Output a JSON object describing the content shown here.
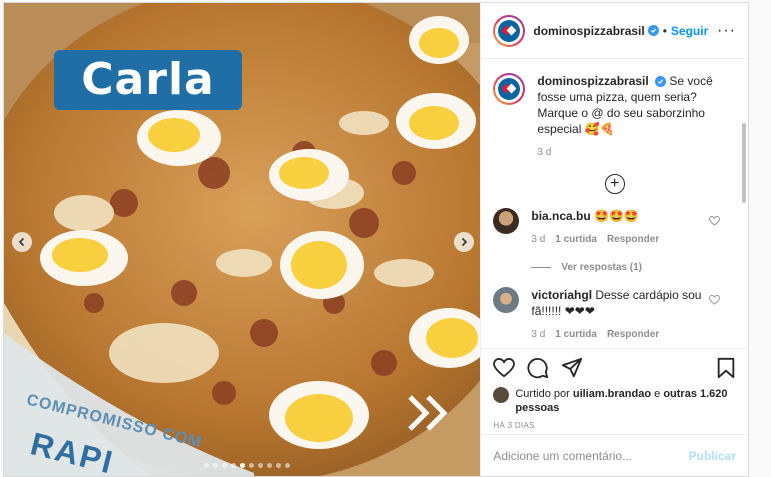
{
  "media": {
    "name_tag": "Carla",
    "box_text_1": "COMPROMISSO COM",
    "box_text_2": "RAPI",
    "slide_count": 10,
    "active_slide": 4
  },
  "header": {
    "username": "dominospizzabrasil",
    "bullet": "•",
    "follow_label": "Seguir",
    "more_label": "···",
    "avatar_icon": "dominos-logo-icon",
    "avatar_text": "Domino's Pizza"
  },
  "caption": {
    "username": "dominospizzabrasil",
    "text": "Se você fosse uma pizza, quem seria? Marque o @ do seu saborzinho especial 🥰🍕",
    "age": "3 d"
  },
  "load_more_label": "+",
  "comments": [
    {
      "username": "bia.nca.bu",
      "text": "🤩🤩🤩",
      "age": "3 d",
      "likes": "1 curtida",
      "reply_label": "Responder",
      "view_replies": "Ver respostas (1)"
    },
    {
      "username": "victoriahgl",
      "text": "Desse cardápio sou fã!!!!!! ❤❤❤",
      "age": "3 d",
      "likes": "1 curtida",
      "reply_label": "Responder"
    }
  ],
  "likes": {
    "prefix": "Curtido por ",
    "user": "uiliam.brandao",
    "middle": " e ",
    "others": "outras 1.620 pessoas"
  },
  "date": "HÁ 3 DIAS",
  "add_comment": {
    "placeholder": "Adicione um comentário...",
    "publish_label": "Publicar"
  },
  "colors": {
    "accent": "#0095f6",
    "name_tag": "#1f6fa6",
    "heart_red": "#ed1c24"
  }
}
